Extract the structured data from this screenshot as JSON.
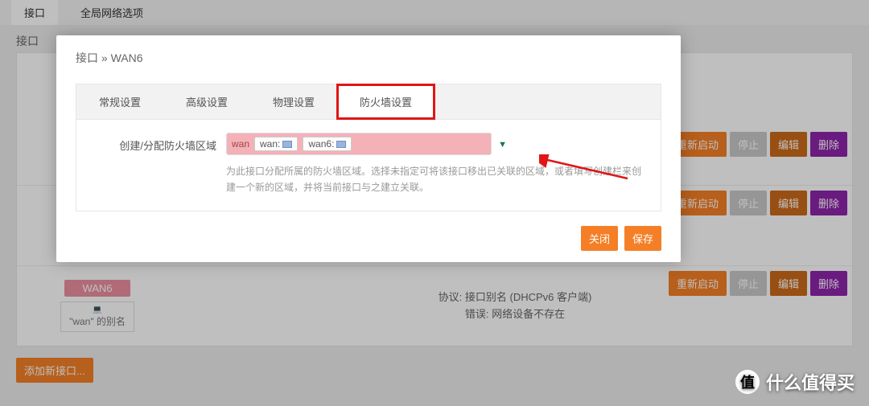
{
  "page": {
    "tabs": [
      "接口",
      "全局网络选项"
    ],
    "section_title": "接口"
  },
  "rows": {
    "restart": "重新启动",
    "stop": "停止",
    "edit": "编辑",
    "delete": "删除"
  },
  "wan6": {
    "name": "WAN6",
    "alias": "\"wan\" 的别名",
    "proto_line": "协议: 接口别名 (DHCPv6 客户端)",
    "error_line": "错误: 网络设备不存在"
  },
  "add_button": "添加新接口...",
  "modal": {
    "breadcrumb": "接口 » WAN6",
    "tabs": [
      "常规设置",
      "高级设置",
      "物理设置",
      "防火墙设置"
    ],
    "field_label": "创建/分配防火墙区域",
    "zone_name": "wan",
    "zone_tags": [
      "wan:",
      "wan6:"
    ],
    "help": "为此接口分配所属的防火墙区域。选择未指定可将该接口移出已关联的区域，或者填写创建栏来创建一个新的区域，并将当前接口与之建立关联。",
    "close": "关闭",
    "save": "保存"
  },
  "watermark": "什么值得买"
}
